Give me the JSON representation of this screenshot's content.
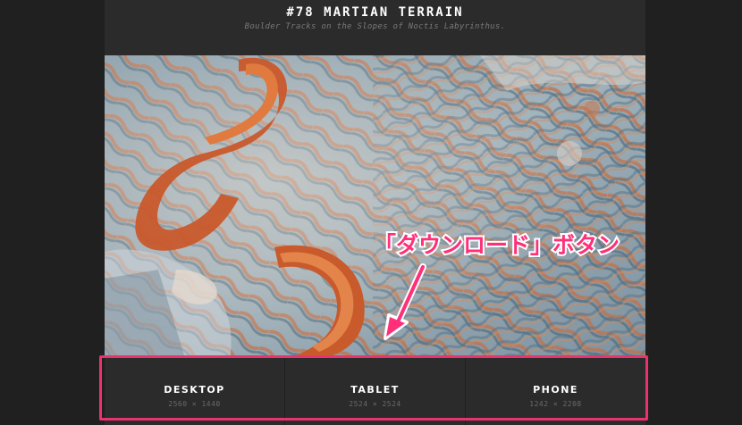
{
  "header": {
    "title": "#78 MARTIAN TERRAIN",
    "subtitle": "Boulder Tracks on the Slopes of Noctis Labyrinthus."
  },
  "image": {
    "subject": "martian-terrain-photo"
  },
  "downloads": [
    {
      "label": "DESKTOP",
      "size": "2560 × 1440"
    },
    {
      "label": "TABLET",
      "size": "2524 × 2524"
    },
    {
      "label": "PHONE",
      "size": "1242 × 2208"
    }
  ],
  "annotation": {
    "text": "「ダウンロード」ボタン",
    "color": "#ff2f7a",
    "highlight_color": "#e8336f"
  },
  "colors": {
    "background": "#202020",
    "panel": "#2b2b2b"
  }
}
